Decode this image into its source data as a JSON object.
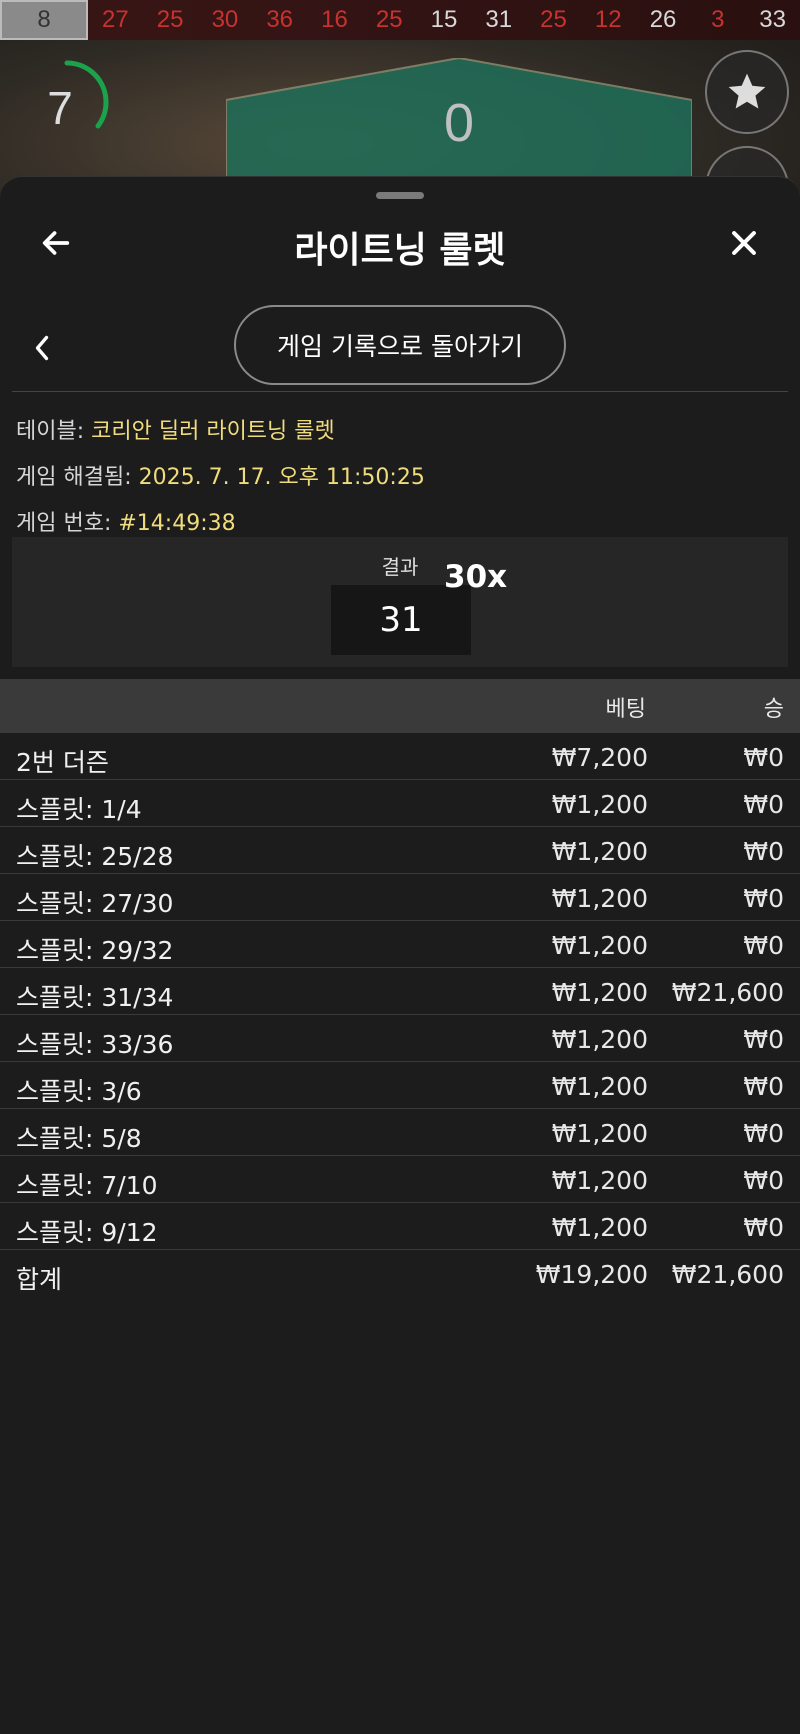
{
  "history": {
    "current": "8",
    "numbers": [
      {
        "value": "27",
        "color": "red"
      },
      {
        "value": "25",
        "color": "red"
      },
      {
        "value": "30",
        "color": "red"
      },
      {
        "value": "36",
        "color": "red"
      },
      {
        "value": "16",
        "color": "red"
      },
      {
        "value": "25",
        "color": "red"
      },
      {
        "value": "15",
        "color": "black"
      },
      {
        "value": "31",
        "color": "black"
      },
      {
        "value": "25",
        "color": "red"
      },
      {
        "value": "12",
        "color": "red"
      },
      {
        "value": "26",
        "color": "black"
      },
      {
        "value": "3",
        "color": "red"
      },
      {
        "value": "33",
        "color": "black"
      }
    ]
  },
  "game": {
    "timer": "7",
    "zero_label": "0"
  },
  "sheet": {
    "title": "라이트닝 룰렛",
    "back_icon": "arrow-left-icon",
    "close_icon": "close-icon",
    "history_button": "게임 기록으로 돌아가기"
  },
  "info": {
    "table_label": "테이블:",
    "table_value": "코리안 딜러 라이트닝 룰렛",
    "resolved_label": "게임 해결됨:",
    "resolved_value": "2025. 7. 17. 오후 11:50:25",
    "number_label": "게임 번호:",
    "number_value": "#14:49:38"
  },
  "result": {
    "label": "결과",
    "value": "31",
    "multiplier": "30x"
  },
  "table": {
    "headers": {
      "bet": "베팅",
      "win": "승"
    },
    "rows": [
      {
        "name": "2번 더즌",
        "bet": "₩7,200",
        "win": "₩0"
      },
      {
        "name": "스플릿: 1/4",
        "bet": "₩1,200",
        "win": "₩0"
      },
      {
        "name": "스플릿: 25/28",
        "bet": "₩1,200",
        "win": "₩0"
      },
      {
        "name": "스플릿: 27/30",
        "bet": "₩1,200",
        "win": "₩0"
      },
      {
        "name": "스플릿: 29/32",
        "bet": "₩1,200",
        "win": "₩0"
      },
      {
        "name": "스플릿: 31/34",
        "bet": "₩1,200",
        "win": "₩21,600"
      },
      {
        "name": "스플릿: 33/36",
        "bet": "₩1,200",
        "win": "₩0"
      },
      {
        "name": "스플릿: 3/6",
        "bet": "₩1,200",
        "win": "₩0"
      },
      {
        "name": "스플릿: 5/8",
        "bet": "₩1,200",
        "win": "₩0"
      },
      {
        "name": "스플릿: 7/10",
        "bet": "₩1,200",
        "win": "₩0"
      },
      {
        "name": "스플릿: 9/12",
        "bet": "₩1,200",
        "win": "₩0"
      }
    ],
    "total": {
      "name": "합계",
      "bet": "₩19,200",
      "win": "₩21,600"
    }
  },
  "colors": {
    "accent_value": "#f0dc7c",
    "red": "#c8322e",
    "felt": "#1f6e58"
  }
}
